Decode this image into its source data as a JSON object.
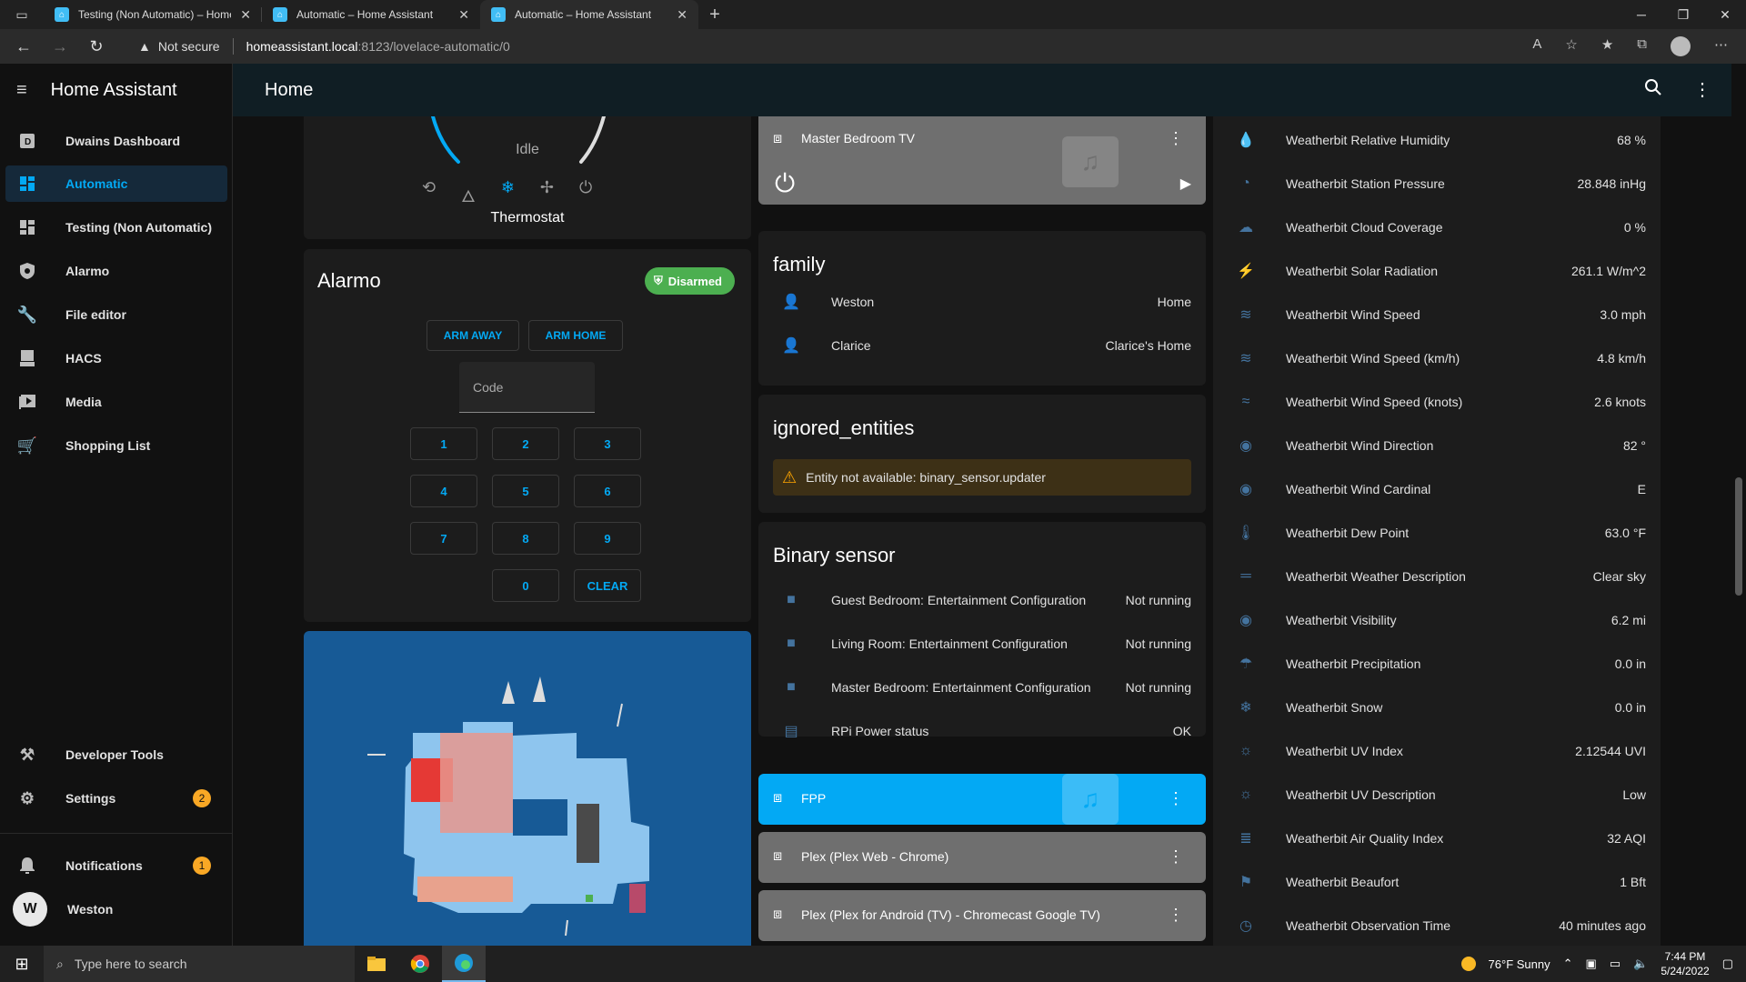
{
  "browser": {
    "tabs": [
      {
        "title": "Testing (Non Automatic) – Home Assistant",
        "active": false
      },
      {
        "title": "Automatic – Home Assistant",
        "active": false
      },
      {
        "title": "Automatic – Home Assistant",
        "active": true
      }
    ],
    "security_label": "Not secure",
    "url_host": "homeassistant.local",
    "url_path": ":8123/lovelace-automatic/0"
  },
  "header": {
    "app_title": "Home Assistant",
    "page_title": "Home"
  },
  "sidebar": {
    "items": [
      {
        "label": "Dwains Dashboard",
        "icon": "dashboard-icon"
      },
      {
        "label": "Automatic",
        "icon": "grid-icon",
        "active": true
      },
      {
        "label": "Testing (Non Automatic)",
        "icon": "grid-icon"
      },
      {
        "label": "Alarmo",
        "icon": "shield-icon"
      },
      {
        "label": "File editor",
        "icon": "wrench-icon"
      },
      {
        "label": "HACS",
        "icon": "hacs-icon"
      },
      {
        "label": "Media",
        "icon": "media-icon"
      },
      {
        "label": "Shopping List",
        "icon": "cart-icon"
      }
    ],
    "developer_tools": "Developer Tools",
    "settings": "Settings",
    "settings_badge": "2",
    "notifications": "Notifications",
    "notifications_badge": "1",
    "user_name": "Weston",
    "user_initial": "W"
  },
  "thermostat": {
    "state": "Idle",
    "name": "Thermostat"
  },
  "alarmo": {
    "title": "Alarmo",
    "status": "Disarmed",
    "arm_away": "ARM AWAY",
    "arm_home": "ARM HOME",
    "code_placeholder": "Code",
    "keys": [
      "1",
      "2",
      "3",
      "4",
      "5",
      "6",
      "7",
      "8",
      "9",
      "0",
      "CLEAR"
    ]
  },
  "media_master": {
    "name": "Master Bedroom TV"
  },
  "family": {
    "title": "family",
    "people": [
      {
        "name": "Weston",
        "state": "Home"
      },
      {
        "name": "Clarice",
        "state": "Clarice's Home"
      }
    ]
  },
  "ignored": {
    "title": "ignored_entities",
    "warning": "Entity not available: binary_sensor.updater"
  },
  "binary_sensor": {
    "title": "Binary sensor",
    "rows": [
      {
        "name": "Guest Bedroom: Entertainment Configuration",
        "state": "Not running"
      },
      {
        "name": "Living Room: Entertainment Configuration",
        "state": "Not running"
      },
      {
        "name": "Master Bedroom: Entertainment Configuration",
        "state": "Not running"
      },
      {
        "name": "RPi Power status",
        "state": "OK"
      }
    ]
  },
  "media_players": [
    {
      "name": "FPP",
      "color": "#03a9f4"
    },
    {
      "name": "Plex (Plex Web - Chrome)",
      "color": "#6f6f6f"
    },
    {
      "name": "Plex (Plex for Android (TV) - Chromecast Google TV)",
      "color": "#6f6f6f"
    }
  ],
  "weather": [
    {
      "name": "Weatherbit Relative Humidity",
      "value": "68 %",
      "icon": "water-percent-icon"
    },
    {
      "name": "Weatherbit Station Pressure",
      "value": "28.848 inHg",
      "icon": "gauge-icon"
    },
    {
      "name": "Weatherbit Cloud Coverage",
      "value": "0 %",
      "icon": "cloud-icon"
    },
    {
      "name": "Weatherbit Solar Radiation",
      "value": "261.1 W/m^2",
      "icon": "solar-icon"
    },
    {
      "name": "Weatherbit Wind Speed",
      "value": "3.0 mph",
      "icon": "wind-icon"
    },
    {
      "name": "Weatherbit Wind Speed (km/h)",
      "value": "4.8 km/h",
      "icon": "wind-icon"
    },
    {
      "name": "Weatherbit Wind Speed (knots)",
      "value": "2.6 knots",
      "icon": "wind-knots-icon"
    },
    {
      "name": "Weatherbit Wind Direction",
      "value": "82 °",
      "icon": "compass-icon"
    },
    {
      "name": "Weatherbit Wind Cardinal",
      "value": "E",
      "icon": "compass-icon"
    },
    {
      "name": "Weatherbit Dew Point",
      "value": "63.0 °F",
      "icon": "thermometer-icon"
    },
    {
      "name": "Weatherbit Weather Description",
      "value": "Clear sky",
      "icon": "text-icon"
    },
    {
      "name": "Weatherbit Visibility",
      "value": "6.2 mi",
      "icon": "eye-icon"
    },
    {
      "name": "Weatherbit Precipitation",
      "value": "0.0 in",
      "icon": "rain-icon"
    },
    {
      "name": "Weatherbit Snow",
      "value": "0.0 in",
      "icon": "snowflake-icon"
    },
    {
      "name": "Weatherbit UV Index",
      "value": "2.12544 UVI",
      "icon": "sun-icon"
    },
    {
      "name": "Weatherbit UV Description",
      "value": "Low",
      "icon": "sun-icon"
    },
    {
      "name": "Weatherbit Air Quality Index",
      "value": "32 AQI",
      "icon": "air-icon"
    },
    {
      "name": "Weatherbit Beaufort",
      "value": "1 Bft",
      "icon": "flag-icon"
    },
    {
      "name": "Weatherbit Observation Time",
      "value": "40 minutes ago",
      "icon": "clock-icon"
    }
  ],
  "taskbar": {
    "search_placeholder": "Type here to search",
    "weather": "76°F  Sunny",
    "time": "7:44 PM",
    "date": "5/24/2022"
  }
}
